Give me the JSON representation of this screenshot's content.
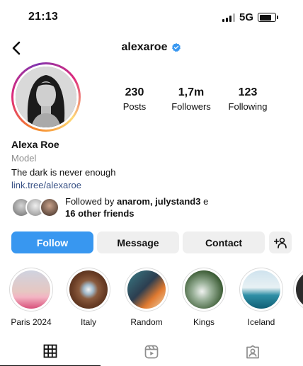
{
  "status_bar": {
    "time": "21:13",
    "network": "5G",
    "battery_level": 0.8
  },
  "header": {
    "username": "alexaroe",
    "verified": true,
    "back_icon": "chevron-left-icon",
    "verified_icon": "verified-badge-icon"
  },
  "profile": {
    "stats": [
      {
        "count": "230",
        "label": "Posts"
      },
      {
        "count": "1,7m",
        "label": "Followers"
      },
      {
        "count": "123",
        "label": "Following"
      }
    ],
    "name": "Alexa Roe",
    "category": "Model",
    "bio": "The dark is never enough",
    "link": "link.tree/alexaroe",
    "followed_by": {
      "prefix": "Followed by ",
      "names": "anarom, julystand3",
      "connector": " e",
      "others": "16 other friends"
    }
  },
  "actions": {
    "follow_label": "Follow",
    "message_label": "Message",
    "contact_label": "Contact",
    "add_user_icon": "add-user-icon"
  },
  "highlights": [
    {
      "label": "Paris 2024"
    },
    {
      "label": "Italy"
    },
    {
      "label": "Random"
    },
    {
      "label": "Kings"
    },
    {
      "label": "Iceland"
    }
  ],
  "tabs": [
    {
      "icon": "grid-icon",
      "active": true
    },
    {
      "icon": "reels-icon",
      "active": false
    },
    {
      "icon": "tagged-icon",
      "active": false
    }
  ],
  "colors": {
    "accent": "#3897f0",
    "link": "#385185",
    "secondary_button": "#efefef",
    "muted_text": "#8e8e8e"
  }
}
